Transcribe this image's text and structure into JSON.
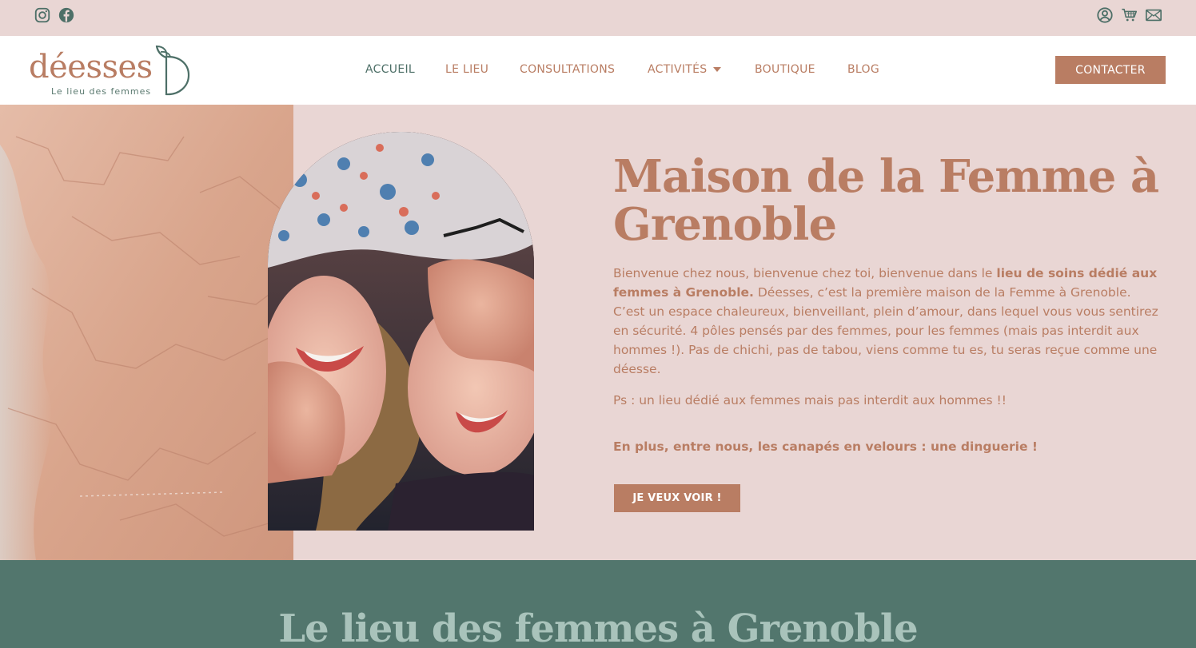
{
  "topbar": {
    "social_icons": [
      "instagram-icon",
      "facebook-icon"
    ],
    "utility_icons": [
      "account-icon",
      "cart-icon",
      "mail-icon"
    ]
  },
  "brand": {
    "name": "déesses",
    "tagline": "Le lieu des femmes"
  },
  "nav": {
    "items": [
      {
        "label": "ACCUEIL",
        "active": true
      },
      {
        "label": "LE LIEU"
      },
      {
        "label": "CONSULTATIONS"
      },
      {
        "label": "ACTIVITÉS",
        "has_dropdown": true
      },
      {
        "label": "BOUTIQUE"
      },
      {
        "label": "BLOG"
      }
    ],
    "contact_label": "CONTACTER"
  },
  "hero": {
    "title": "Maison de la Femme à Grenoble",
    "p1_a": "Bienvenue chez nous, bienvenue chez toi, bienvenue dans le ",
    "p1_bold": "lieu de soins dédié aux femmes à Grenoble.",
    "p1_b": " Déesses, c’est la première maison de la Femme à Grenoble. C’est un espace chaleureux, bienveillant, plein d’amour, dans lequel vous vous sentirez en sécurité. 4 pôles pensés par des femmes, pour les femmes (mais pas interdit aux hommes !). Pas de chichi, pas de tabou, viens comme tu es, tu seras reçue comme une déesse.",
    "p2": "Ps : un lieu dédié aux femmes mais pas interdit aux hommes !!",
    "p3": "En plus, entre nous, les canapés en velours : une dinguerie !",
    "cta_label": "JE VEUX VOIR !"
  },
  "section2": {
    "title": "Le lieu des femmes à Grenoble"
  },
  "colors": {
    "brand_terracotta": "#b97d63",
    "brand_green": "#52766d",
    "nav_active": "#4d6f67",
    "blush_bg": "#e9d6d4",
    "section_title_green": "#a9c3bb"
  }
}
